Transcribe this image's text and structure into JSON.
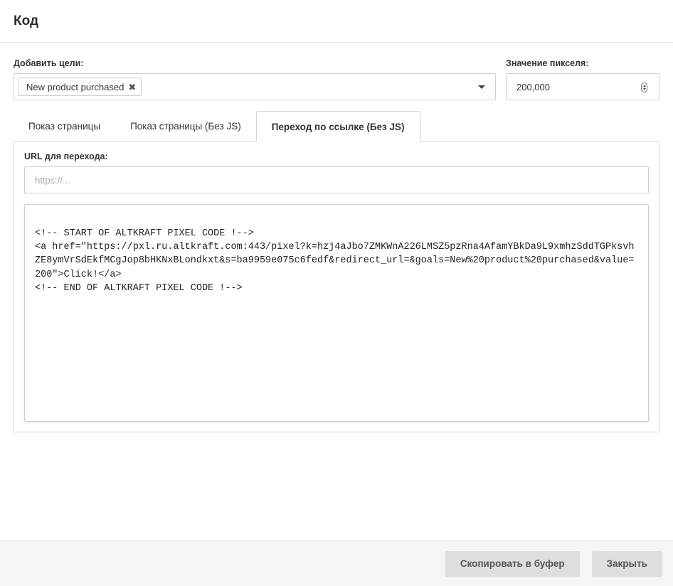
{
  "header": {
    "title": "Код"
  },
  "goals": {
    "label": "Добавить цели:",
    "selected_tags": [
      {
        "label": "New product purchased",
        "remove_glyph": "✖"
      }
    ]
  },
  "pixel_value": {
    "label": "Значение пикселя:",
    "value": "200,000"
  },
  "tabs": [
    {
      "label": "Показ страницы",
      "active": false
    },
    {
      "label": "Показ страницы (Без JS)",
      "active": false
    },
    {
      "label": "Переход по ссылке (Без JS)",
      "active": true
    }
  ],
  "redirect": {
    "label": "URL для перехода:",
    "value": "",
    "placeholder": "https://..."
  },
  "code": {
    "text": "<!-- START OF ALTKRAFT PIXEL CODE !-->\n<a href=\"https://pxl.ru.altkraft.com:443/pixel?k=hzj4aJbo7ZMKWnA226LMSZ5pzRna4AfamYBkDa9L9xmhzSddTGPksvhZE8ymVrSdEkfMCgJop8bHKNxBLondkxt&s=ba9959e075c6fedf&redirect_url=&goals=New%20product%20purchased&value=200\">Click!</a>\n<!-- END OF ALTKRAFT PIXEL CODE !-->"
  },
  "footer": {
    "copy_label": "Скопировать в буфер",
    "close_label": "Закрыть"
  }
}
